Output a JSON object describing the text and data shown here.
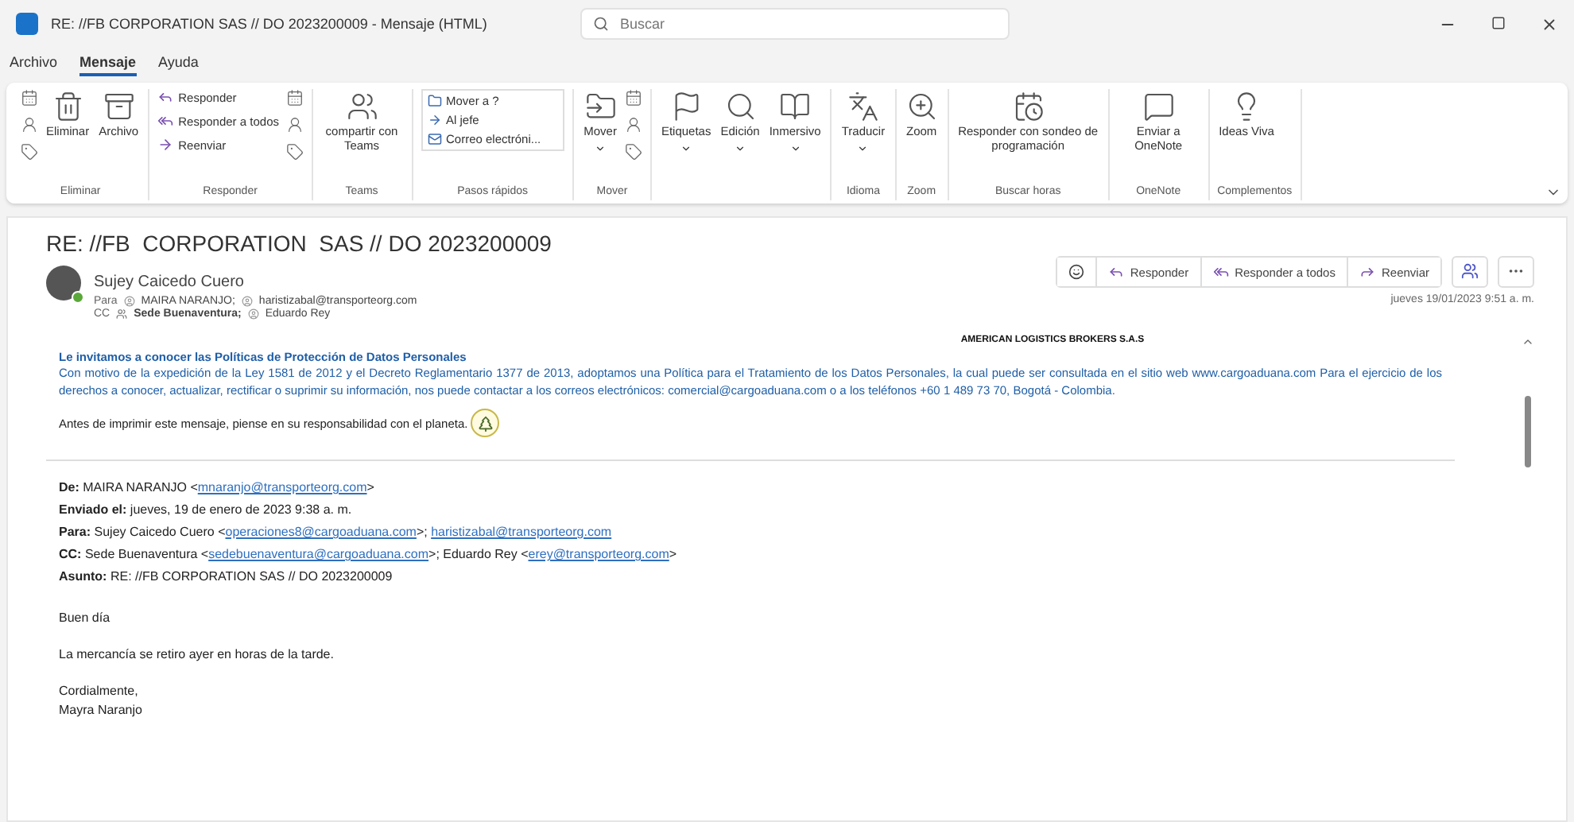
{
  "window": {
    "title": "RE: //FB CORPORATION SAS // DO 2023200009 - Mensaje (HTML)",
    "search": {
      "placeholder": "Buscar"
    }
  },
  "menu_tabs": [
    {
      "label": "Archivo",
      "selected": false
    },
    {
      "label": "Mensaje",
      "selected": true
    },
    {
      "label": "Ayuda",
      "selected": false
    }
  ],
  "ribbon": {
    "groups": [
      {
        "label": "Eliminar",
        "buttons": [
          {
            "kind": "iconstack"
          },
          {
            "kind": "large",
            "label": "Eliminar"
          },
          {
            "kind": "large",
            "label": "Archivo"
          }
        ]
      },
      {
        "label": "Responder",
        "buttons": [
          {
            "kind": "small",
            "label": "Responder"
          },
          {
            "kind": "small",
            "label": "Responder a todos"
          },
          {
            "kind": "small",
            "label": "Reenviar"
          },
          {
            "kind": "iconstack"
          }
        ]
      },
      {
        "label": "Teams",
        "buttons": [
          {
            "kind": "large",
            "label": "compartir con Teams"
          }
        ]
      },
      {
        "label": "Pasos rápidos",
        "buttons": [
          {
            "kind": "quicksteps",
            "items": [
              "Mover a ?",
              "Al jefe",
              "Correo electróni..."
            ]
          }
        ]
      },
      {
        "label": "Mover",
        "buttons": [
          {
            "kind": "large",
            "label": "Mover",
            "dropdown": true
          },
          {
            "kind": "iconstack"
          }
        ]
      },
      {
        "buttons": [
          {
            "kind": "large",
            "label": "Etiquetas",
            "dropdown": true
          },
          {
            "kind": "large",
            "label": "Edición",
            "dropdown": true
          },
          {
            "kind": "large",
            "label": "Inmersivo",
            "dropdown": true
          }
        ]
      },
      {
        "label": "Idioma",
        "buttons": [
          {
            "kind": "large",
            "label": "Traducir",
            "dropdown": true
          }
        ]
      },
      {
        "label": "Zoom",
        "buttons": [
          {
            "kind": "large",
            "label": "Zoom"
          }
        ]
      },
      {
        "label": "Buscar horas",
        "buttons": [
          {
            "kind": "large",
            "label": "Responder con sondeo de programación"
          }
        ]
      },
      {
        "label": "OneNote",
        "buttons": [
          {
            "kind": "large",
            "label": "Enviar a OneNote"
          }
        ]
      },
      {
        "label": "Complementos",
        "buttons": [
          {
            "kind": "large",
            "label": "Ideas Viva"
          }
        ]
      }
    ]
  },
  "message": {
    "subject": "RE: //FB  CORPORATION  SAS // DO 2023200009",
    "sender": "Sujey Caicedo Cuero",
    "to_label": "Para",
    "to": [
      "MAIRA NARANJO;",
      "haristizabal@transporteorg.com"
    ],
    "cc_label": "CC",
    "cc": [
      {
        "name": "Sede Buenaventura;",
        "group": true
      },
      {
        "name": "Eduardo Rey",
        "group": false
      }
    ],
    "actions": [
      {
        "kind": "emoji"
      },
      {
        "kind": "reply",
        "label": "Responder"
      },
      {
        "kind": "replyall",
        "label": "Responder a todos"
      },
      {
        "kind": "forward",
        "label": "Reenviar"
      },
      {
        "kind": "teams"
      },
      {
        "kind": "more"
      }
    ],
    "date": "jueves 19/01/2023 9:51 a. m.",
    "body": {
      "company": "AMERICAN LOGISTICS BROKERS S.A.S",
      "policy_heading": "Le invitamos a conocer las Políticas de Protección de Datos Personales",
      "policy_text": "Con motivo de la expedición de la Ley 1581 de 2012 y el Decreto Reglamentario 1377 de 2013, adoptamos una Política para el Tratamiento de los Datos Personales, la cual puede ser consultada en el sitio web www.cargoaduana.com Para el ejercicio de los derechos a conocer, actualizar, rectificar o suprimir su información, nos puede contactar a los correos electrónicos: comercial@cargoaduana.com o a los teléfonos +60 1 489 73 70, Bogotá - Colombia.",
      "print_note": "Antes de imprimir este mensaje, piense en su responsabilidad con el planeta.",
      "quoted_header": [
        {
          "label": "De:",
          "parts": [
            {
              "text": "MAIRA NARANJO <"
            },
            {
              "text": "mnaranjo@transporteorg.com",
              "kind": "link"
            },
            {
              "text": ">"
            }
          ]
        },
        {
          "label": "Enviado el:",
          "parts": [
            {
              "text": "jueves, 19 de enero de 2023 9:38 a. m."
            }
          ]
        },
        {
          "label": "Para:",
          "parts": [
            {
              "text": "Sujey Caicedo Cuero <"
            },
            {
              "text": "operaciones8@cargoaduana.com",
              "kind": "link"
            },
            {
              "text": ">; "
            },
            {
              "text": "haristizabal@transporteorg.com",
              "kind": "link"
            }
          ]
        },
        {
          "label": "CC:",
          "parts": [
            {
              "text": "Sede Buenaventura <"
            },
            {
              "text": "sedebuenaventura@cargoaduana.com",
              "kind": "link"
            },
            {
              "text": ">; Eduardo Rey <"
            },
            {
              "text": "erey@transporteorg.com",
              "kind": "link"
            },
            {
              "text": ">"
            }
          ]
        },
        {
          "label": "Asunto:",
          "parts": [
            {
              "text": "RE: //FB CORPORATION SAS // DO 2023200009"
            }
          ]
        }
      ],
      "paragraphs": [
        "Buen día",
        "La mercancía se retiro ayer en horas de la tarde.",
        "Cordialmente,"
      ],
      "signature": "Mayra Naranjo"
    }
  }
}
